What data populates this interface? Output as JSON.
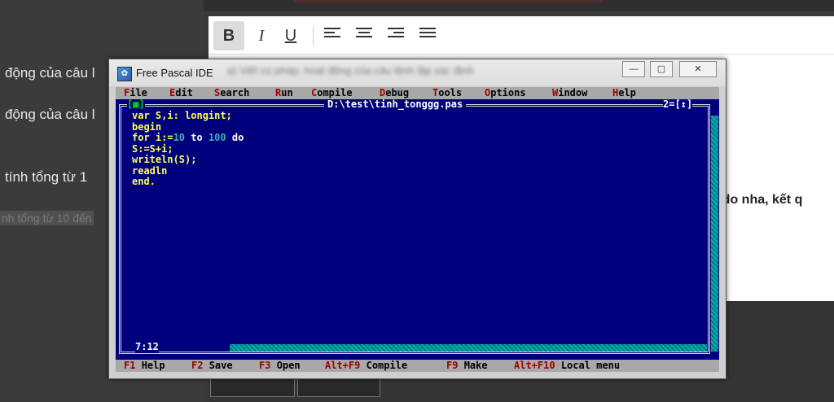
{
  "background": {
    "left_lines": [
      "động của câu l",
      "động của câu l",
      "tính tổng từ 1",
      "nh tổng từ 10 đến"
    ],
    "editor_right_text": "r...do nha, kết q",
    "toolbar": {
      "bold_label": "B",
      "italic_label": "I",
      "underline_label": "U"
    }
  },
  "window": {
    "title": "Free Pascal IDE",
    "blurred_text": "a) Viết cú pháp, hoạt động của câu lệnh lặp xác định",
    "icon": "free-pascal-icon",
    "minimize_glyph": "—",
    "maximize_glyph": "▢",
    "close_glyph": "✕"
  },
  "menu": {
    "items": [
      {
        "hot": "F",
        "rest": "ile"
      },
      {
        "hot": "E",
        "rest": "dit"
      },
      {
        "hot": "S",
        "rest": "earch"
      },
      {
        "hot": "R",
        "rest": "un"
      },
      {
        "hot": "C",
        "rest": "ompile"
      },
      {
        "hot": "D",
        "rest": "ebug"
      },
      {
        "hot": "T",
        "rest": "ools"
      },
      {
        "hot": "O",
        "rest": "ptions"
      },
      {
        "hot": "W",
        "rest": "indow"
      },
      {
        "hot": "H",
        "rest": "elp"
      }
    ]
  },
  "editor": {
    "file_path": "D:\\test\\tinh_tonggg.pas",
    "close_box": "[■]",
    "window_number": "2=[↕]",
    "cursor_position": "7:12",
    "code": {
      "line1": "var S,i: longint;",
      "line2": "begin",
      "line3_a": "for i:=",
      "line3_n1": "10",
      "line3_b": " to ",
      "line3_n2": "100",
      "line3_c": " do",
      "line4": "S:=S+i;",
      "line5": "writeln(S);",
      "line6": "readln",
      "line7": "end."
    }
  },
  "status": {
    "items": [
      {
        "key": "F1",
        "label": "Help"
      },
      {
        "key": "F2",
        "label": "Save"
      },
      {
        "key": "F3",
        "label": "Open"
      },
      {
        "key": "Alt+F9",
        "label": "Compile"
      },
      {
        "key": "F9",
        "label": "Make"
      },
      {
        "key": "Alt+F10",
        "label": "Local menu"
      }
    ]
  }
}
